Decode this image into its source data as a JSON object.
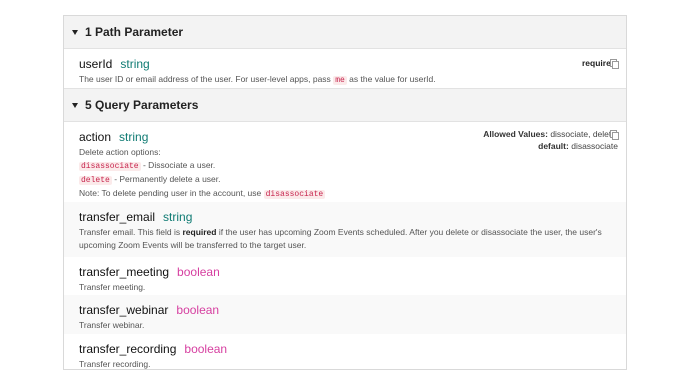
{
  "path_section": {
    "title": "1 Path Parameter",
    "params": [
      {
        "name": "userId",
        "type": "string",
        "required_label": "required",
        "desc_pre": "The user ID or email address of the user. For user-level apps, pass",
        "desc_code": "me",
        "desc_post": "as the value for userId."
      }
    ]
  },
  "query_section": {
    "title": "5 Query Parameters",
    "action": {
      "name": "action",
      "type": "string",
      "allowed_label": "Allowed Values:",
      "allowed_values": "dissociate, delete",
      "default_label": "default:",
      "default_value": "disassociate",
      "desc_intro": "Delete action options:",
      "opt1_code": "disassociate",
      "opt1_text": "- Dissociate a user.",
      "opt2_code": "delete",
      "opt2_text": "- Permanently delete a user.",
      "note_text": "Note: To delete pending user in the account, use",
      "note_code": "disassociate"
    },
    "transfer_email": {
      "name": "transfer_email",
      "type": "string",
      "desc_pre": "Transfer email. This field is",
      "desc_bold": "required",
      "desc_post": "if the user has upcoming Zoom Events scheduled. After you delete or disassociate the user, the user's upcoming Zoom Events will be transferred to the target user."
    },
    "others": [
      {
        "name": "transfer_meeting",
        "type": "boolean",
        "desc": "Transfer meeting."
      },
      {
        "name": "transfer_webinar",
        "type": "boolean",
        "desc": "Transfer webinar."
      },
      {
        "name": "transfer_recording",
        "type": "boolean",
        "desc": "Transfer recording."
      }
    ]
  }
}
